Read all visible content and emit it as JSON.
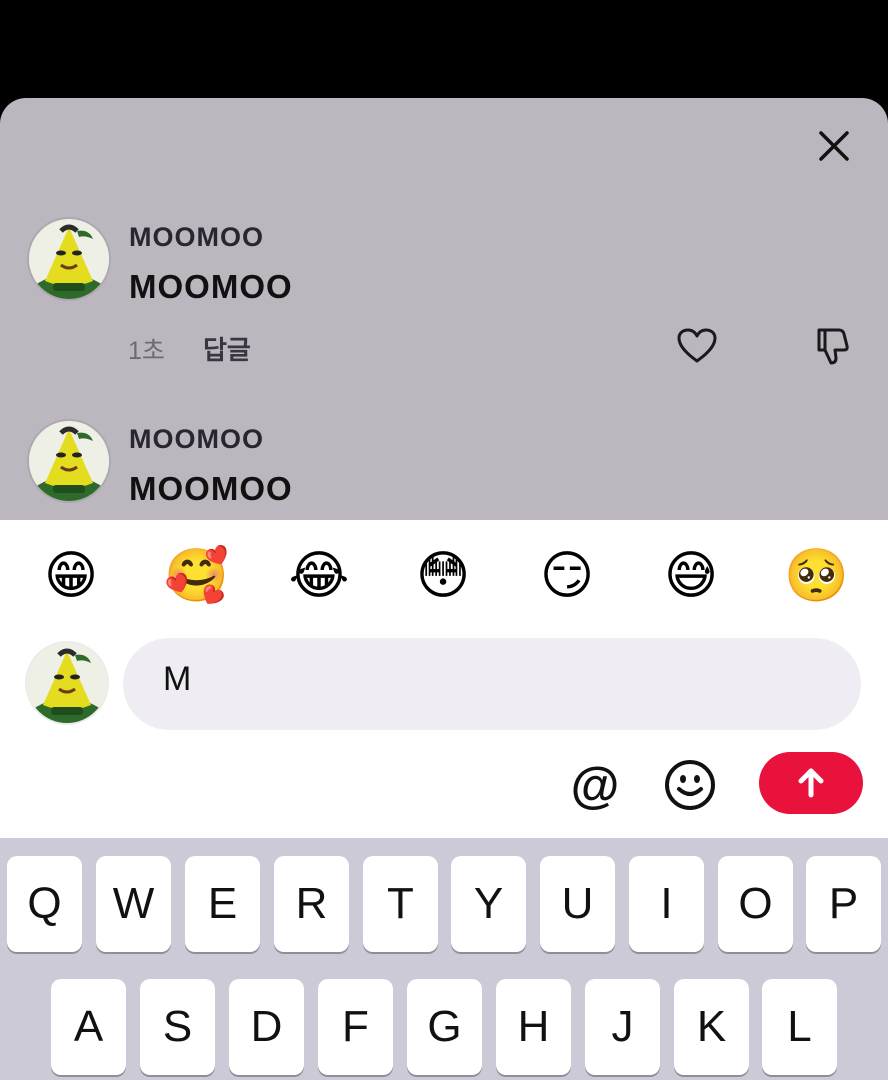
{
  "comments": [
    {
      "username": "MOOMOO",
      "text": "MOOMOO",
      "time": "1초",
      "reply_label": "답글"
    },
    {
      "username": "MOOMOO",
      "text": "MOOMOO"
    }
  ],
  "emoji_bar": [
    "😁",
    "🥰",
    "😂",
    "😳",
    "😏",
    "😅",
    "🥺"
  ],
  "composer": {
    "value": "M"
  },
  "actions": {
    "mention": "@",
    "emoji": "emoji-icon"
  },
  "keyboard": {
    "row1": [
      "Q",
      "W",
      "E",
      "R",
      "T",
      "Y",
      "U",
      "I",
      "O",
      "P"
    ],
    "row2": [
      "A",
      "S",
      "D",
      "F",
      "G",
      "H",
      "J",
      "K",
      "L"
    ]
  },
  "colors": {
    "sheet": "#bcb7bf",
    "send": "#e8123c",
    "keyboard": "#cbcad6"
  }
}
